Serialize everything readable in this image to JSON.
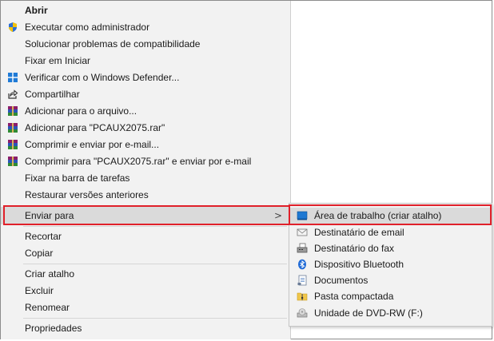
{
  "context_menu": {
    "items": [
      {
        "label": "Abrir",
        "icon": "none"
      },
      {
        "label": "Executar como administrador",
        "icon": "uac-shield-icon"
      },
      {
        "label": "Solucionar problemas de compatibilidade",
        "icon": "none"
      },
      {
        "label": "Fixar em Iniciar",
        "icon": "none"
      },
      {
        "label": "Verificar com o Windows Defender...",
        "icon": "windows-defender-icon"
      },
      {
        "label": "Compartilhar",
        "icon": "share-icon"
      },
      {
        "label": "Adicionar para o arquivo...",
        "icon": "winrar-icon"
      },
      {
        "label": "Adicionar para \"PCAUX2075.rar\"",
        "icon": "winrar-icon"
      },
      {
        "label": "Comprimir e enviar por e-mail...",
        "icon": "winrar-icon"
      },
      {
        "label": "Comprimir para \"PCAUX2075.rar\" e enviar por e-mail",
        "icon": "winrar-icon"
      },
      {
        "label": "Fixar na barra de tarefas",
        "icon": "none"
      },
      {
        "label": "Restaurar versões anteriores",
        "icon": "none"
      },
      {
        "label": "Enviar para",
        "icon": "none"
      },
      {
        "label": "Recortar",
        "icon": "none"
      },
      {
        "label": "Copiar",
        "icon": "none"
      },
      {
        "label": "Criar atalho",
        "icon": "none"
      },
      {
        "label": "Excluir",
        "icon": "none"
      },
      {
        "label": "Renomear",
        "icon": "none"
      },
      {
        "label": "Propriedades",
        "icon": "none"
      }
    ],
    "submenu_arrow": ">"
  },
  "send_to_submenu": {
    "items": [
      {
        "label": "Área de trabalho (criar atalho)",
        "icon": "desktop-icon"
      },
      {
        "label": "Destinatário de email",
        "icon": "mail-recipient-icon"
      },
      {
        "label": "Destinatário do fax",
        "icon": "fax-icon"
      },
      {
        "label": "Dispositivo Bluetooth",
        "icon": "bluetooth-icon"
      },
      {
        "label": "Documentos",
        "icon": "documents-icon"
      },
      {
        "label": "Pasta compactada",
        "icon": "zip-folder-icon"
      },
      {
        "label": "Unidade de DVD-RW (F:)",
        "icon": "dvd-drive-icon"
      }
    ]
  },
  "colors": {
    "menu_bg": "#f2f2f2",
    "hover_bg": "#dadada",
    "highlight_border": "#e0202a",
    "separator": "#d6d6d6"
  }
}
